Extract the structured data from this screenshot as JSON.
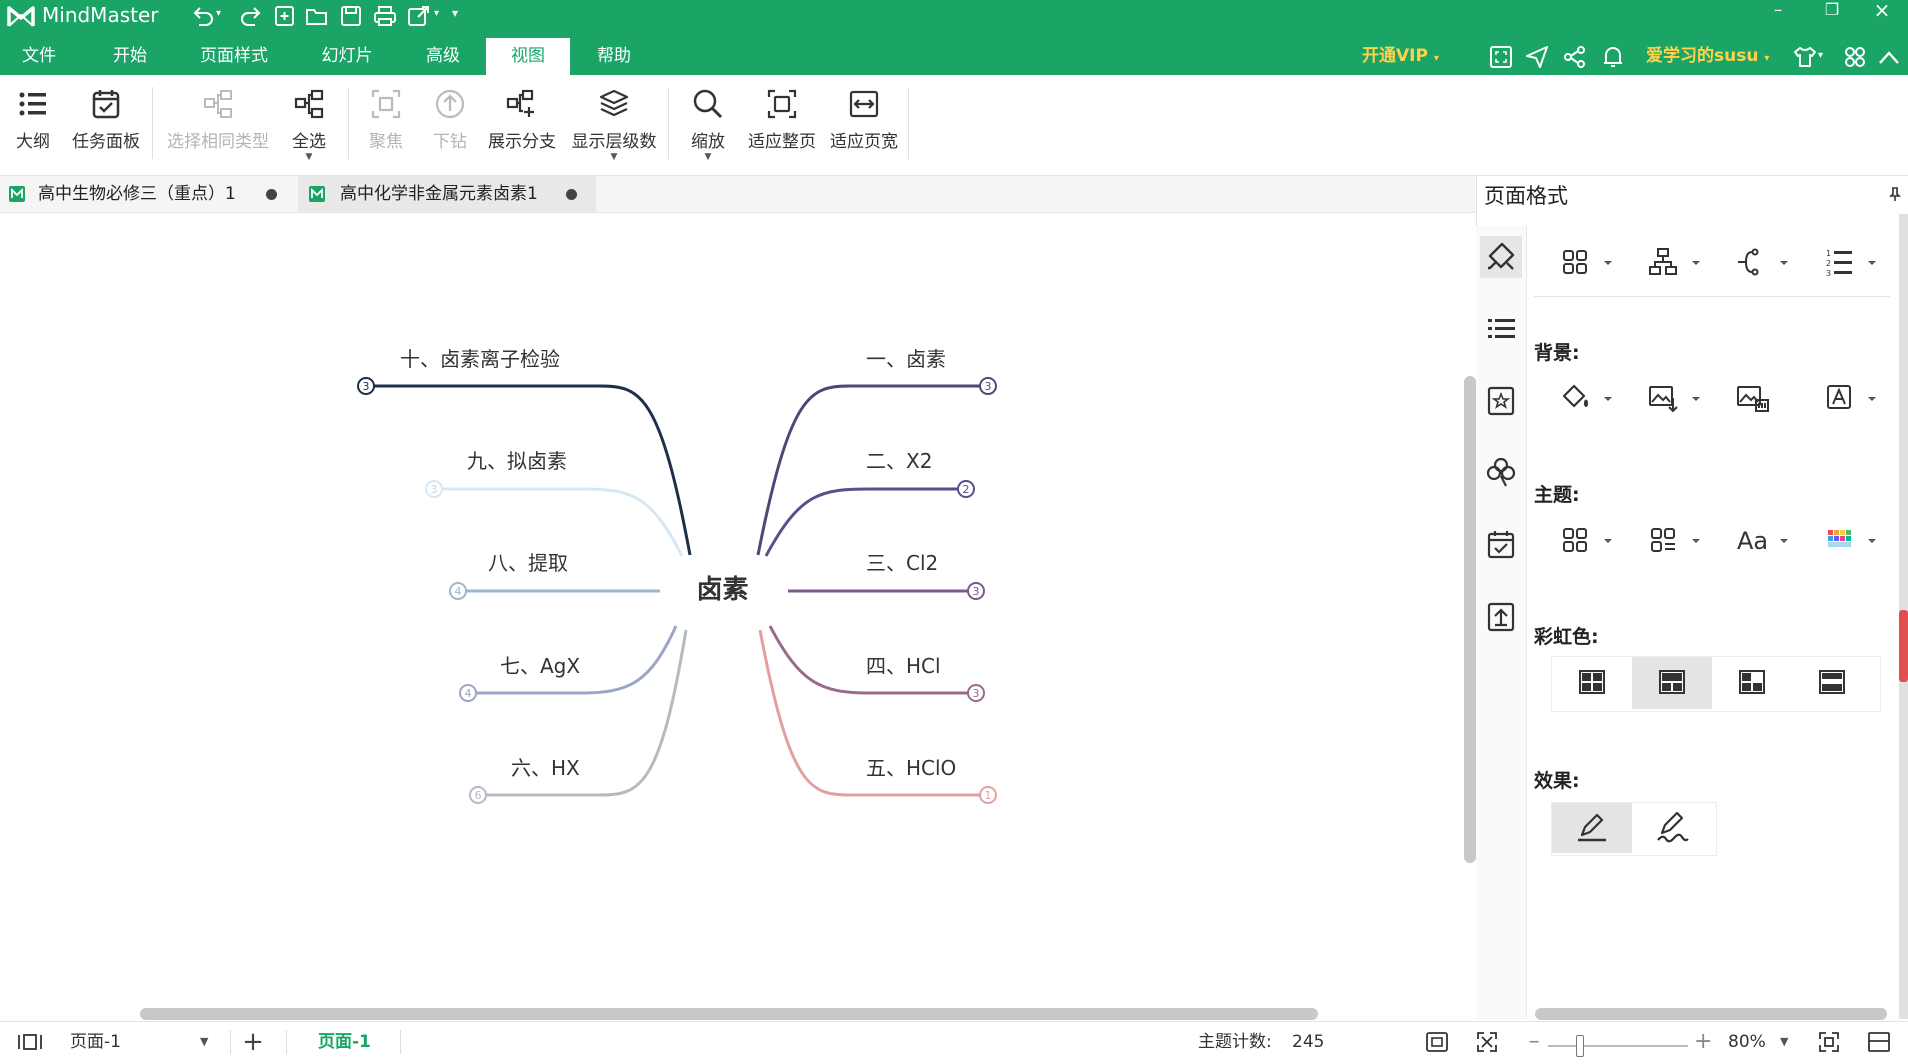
{
  "app": {
    "name": "MindMaster"
  },
  "menu": {
    "items": [
      "文件",
      "开始",
      "页面样式",
      "幻灯片",
      "高级",
      "视图",
      "帮助"
    ],
    "active": "视图",
    "vip": "开通VIP",
    "user": "爱学习的susu"
  },
  "ribbon": {
    "outline": "大纲",
    "task_panel": "任务面板",
    "select_same_type": "选择相同类型",
    "select_all": "全选",
    "focus": "聚焦",
    "drill_down": "下钻",
    "expand_branch": "展示分支",
    "show_levels": "显示层级数",
    "zoom": "缩放",
    "fit_page": "适应整页",
    "fit_width": "适应页宽"
  },
  "tabs": [
    {
      "label": "高中生物必修三（重点）1",
      "active": false
    },
    {
      "label": "高中化学非金属元素卤素1",
      "active": true
    }
  ],
  "mindmap": {
    "central": "卤素",
    "right_branches": [
      {
        "label": "一、卤素",
        "count": "3",
        "color": "#4a4a78"
      },
      {
        "label": "二、X2",
        "count": "2",
        "color": "#5b4e8a"
      },
      {
        "label": "三、Cl2",
        "count": "3",
        "color": "#7b5a90"
      },
      {
        "label": "四、HCl",
        "count": "3",
        "color": "#9a6a8c"
      },
      {
        "label": "五、HClO",
        "count": "1",
        "color": "#e4a0a0"
      }
    ],
    "left_branches": [
      {
        "label": "十、卤素离子检验",
        "count": "3",
        "color": "#1e2f4a"
      },
      {
        "label": "九、拟卤素",
        "count": "3",
        "color": "#d6e8f4"
      },
      {
        "label": "八、提取",
        "count": "4",
        "color": "#9fb6d2"
      },
      {
        "label": "七、AgX",
        "count": "4",
        "color": "#9aa6c4"
      },
      {
        "label": "六、HX",
        "count": "6",
        "color": "#b9b9c4"
      }
    ]
  },
  "panel": {
    "title": "页面格式",
    "background_label": "背景:",
    "theme_label": "主题:",
    "rainbow_label": "彩虹色:",
    "effect_label": "效果:"
  },
  "status": {
    "page_select": "页面-1",
    "page_tab": "页面-1",
    "topic_count_label": "主题计数:",
    "topic_count": "245",
    "zoom": "80%"
  },
  "zoom_level": 0.8
}
